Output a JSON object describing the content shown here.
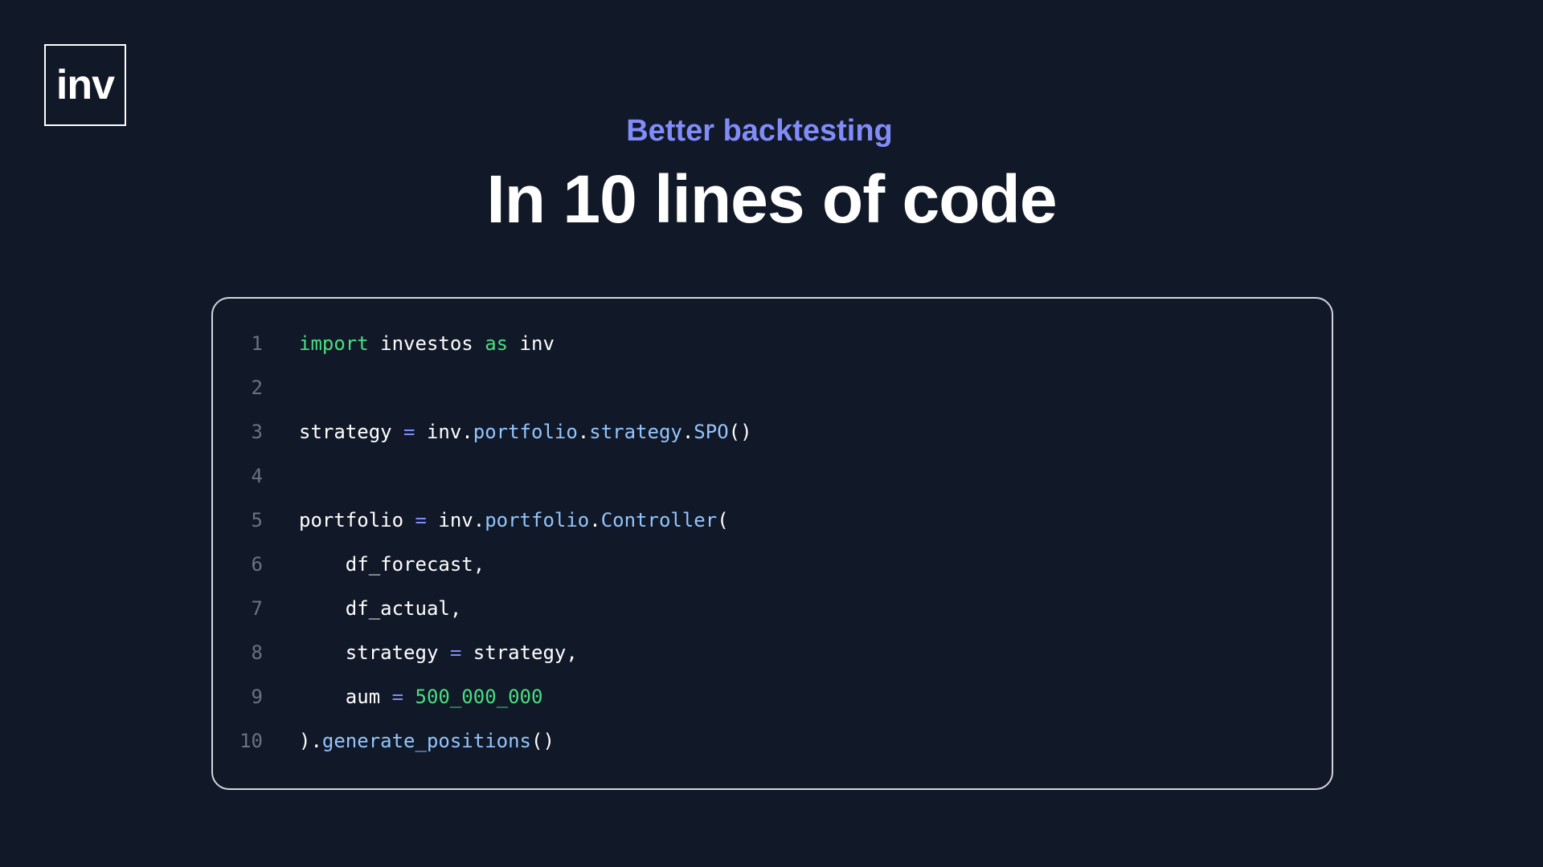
{
  "logo": {
    "text": "inv"
  },
  "header": {
    "eyebrow": "Better backtesting",
    "title": "In 10 lines of code"
  },
  "code": {
    "lines": [
      {
        "number": "1",
        "tokens": [
          {
            "text": "import",
            "type": "keyword"
          },
          {
            "text": " investos ",
            "type": "plain"
          },
          {
            "text": "as",
            "type": "keyword"
          },
          {
            "text": " inv",
            "type": "plain"
          }
        ]
      },
      {
        "number": "2",
        "tokens": []
      },
      {
        "number": "3",
        "tokens": [
          {
            "text": "strategy ",
            "type": "plain"
          },
          {
            "text": "=",
            "type": "op"
          },
          {
            "text": " inv.",
            "type": "plain"
          },
          {
            "text": "portfolio",
            "type": "func"
          },
          {
            "text": ".",
            "type": "plain"
          },
          {
            "text": "strategy",
            "type": "func"
          },
          {
            "text": ".",
            "type": "plain"
          },
          {
            "text": "SPO",
            "type": "func"
          },
          {
            "text": "()",
            "type": "plain"
          }
        ]
      },
      {
        "number": "4",
        "tokens": []
      },
      {
        "number": "5",
        "tokens": [
          {
            "text": "portfolio ",
            "type": "plain"
          },
          {
            "text": "=",
            "type": "op"
          },
          {
            "text": " inv.",
            "type": "plain"
          },
          {
            "text": "portfolio",
            "type": "func"
          },
          {
            "text": ".",
            "type": "plain"
          },
          {
            "text": "Controller",
            "type": "func"
          },
          {
            "text": "(",
            "type": "plain"
          }
        ]
      },
      {
        "number": "6",
        "tokens": [
          {
            "text": "    df_forecast,",
            "type": "plain"
          }
        ]
      },
      {
        "number": "7",
        "tokens": [
          {
            "text": "    df_actual,",
            "type": "plain"
          }
        ]
      },
      {
        "number": "8",
        "tokens": [
          {
            "text": "    strategy ",
            "type": "plain"
          },
          {
            "text": "=",
            "type": "op"
          },
          {
            "text": " strategy,",
            "type": "plain"
          }
        ]
      },
      {
        "number": "9",
        "tokens": [
          {
            "text": "    aum ",
            "type": "plain"
          },
          {
            "text": "=",
            "type": "op"
          },
          {
            "text": " ",
            "type": "plain"
          },
          {
            "text": "500_000_000",
            "type": "number"
          }
        ]
      },
      {
        "number": "10",
        "tokens": [
          {
            "text": ").",
            "type": "plain"
          },
          {
            "text": "generate_positions",
            "type": "func"
          },
          {
            "text": "()",
            "type": "plain"
          }
        ]
      }
    ]
  }
}
